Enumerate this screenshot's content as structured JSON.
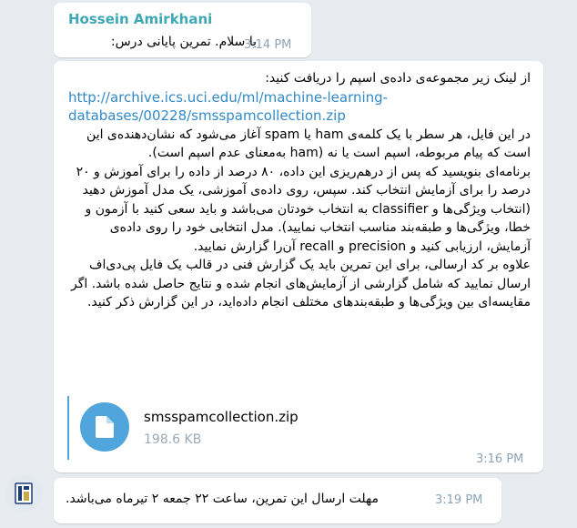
{
  "messages": {
    "m1": {
      "sender": "Hossein Amirkhani",
      "text": "با سلام. تمرین پایانی درس:",
      "time": "3:14 PM"
    },
    "m2": {
      "intro": "از لینک زیر مجموعه‌ی داده‌ی اسپم را دریافت کنید:",
      "link_line1": "http://archive.ics.uci.edu/ml/machine-learning-",
      "link_line2": "databases/00228/smsspamcollection.zip",
      "para1": "در این فایل، هر سطر با یک کلمه‌ی ham یا spam آغاز می‌شود که نشان‌دهنده‌ی این است که پیام مربوطه، اسپم است یا نه (ham به‌معنای عدم اسپم است).",
      "para2": "برنامه‌ای بنویسید که پس از درهم‌ریزی این داده، ۸۰ درصد از داده را برای آموزش و ۲۰ درصد را برای آزمایش انتخاب کند. سپس، روی داده‌ی آموزشی، یک مدل آموزش دهید (انتخاب ویژگی‌ها و classifier به انتخاب خودتان می‌باشد و باید سعی کنید با آزمون و خطا، ویژگی‌ها و طبقه‌بند مناسب انتخاب نمایید). مدل انتخابی خود را روی داده‌ی آزمایش، ارزیابی کنید و precision و recall آن‌را گزارش نمایید.",
      "para3": "علاوه بر کد ارسالی، برای این تمرین باید یک گزارش فنی در قالب یک فایل پی‌دی‌اف ارسال نمایید که شامل گزارشی از آزمایش‌های انجام شده و نتایج حاصل شده باشد. اگر مقایسه‌ای بین ویژگی‌ها و طبقه‌بندهای مختلف انجام داده‌اید، در این گزارش ذکر کنید.",
      "file_name": "smsspamcollection.zip",
      "file_size": "198.6 KB",
      "time": "3:16 PM"
    },
    "m3": {
      "text": "مهلت ارسال این تمرین، ساعت ۲۲ جمعه ۲ تیرماه می‌باشد.",
      "time": "3:19 PM"
    }
  },
  "colors": {
    "background": "#e7ebf0",
    "sender_name": "#3fa8b5",
    "link": "#3289c7",
    "file_accent": "#4fa5dc",
    "time": "#8da3b4"
  },
  "icons": {
    "file": "document-icon",
    "avatar": "avatar-logo"
  }
}
